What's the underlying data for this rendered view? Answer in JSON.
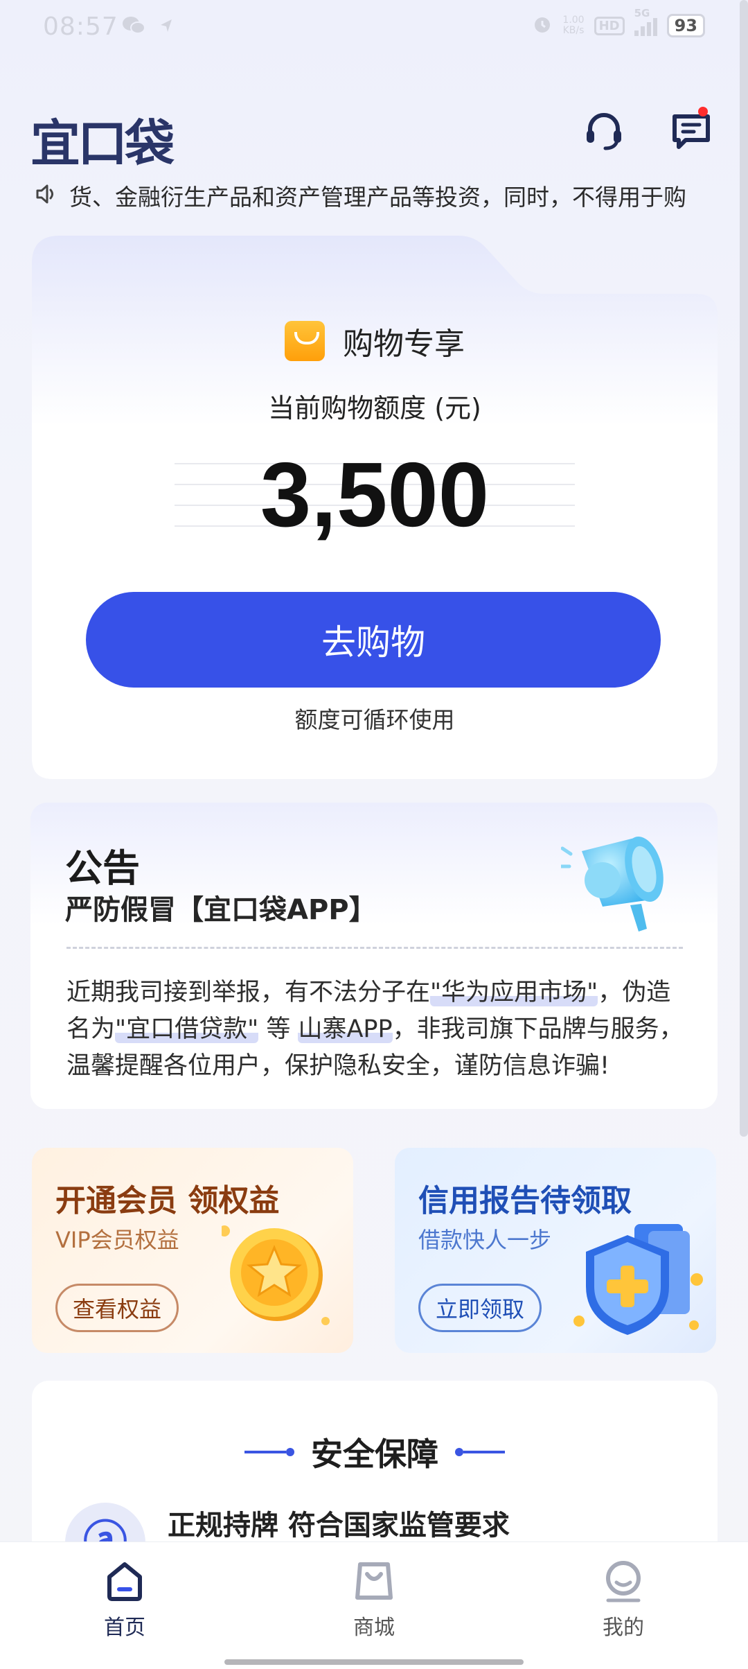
{
  "status_bar": {
    "time": "08:57",
    "net_speed_value": "1.00",
    "net_speed_unit": "KB/s",
    "hd": "HD",
    "network": "5G",
    "battery": "93"
  },
  "header": {
    "logo": "宜口袋"
  },
  "notice_ticker": {
    "text": "货、金融衍生产品和资产管理产品等投资，同时，不得用于购"
  },
  "credit": {
    "tag": "购物专享",
    "caption": "当前购物额度 (元)",
    "amount": "3,500",
    "button": "去购物",
    "note": "额度可循环使用"
  },
  "announcement": {
    "title": "公告",
    "subtitle": "严防假冒【宜口袋APP】",
    "body_1": "近期我司接到举报，有不法分子在",
    "highlight_1": "\"华为应用市场\"",
    "body_2": "，伪造名为",
    "highlight_2": "\"宜口借贷款\"",
    "body_3": " 等 ",
    "highlight_3": "山寨APP",
    "body_4": "，非我司旗下品牌与服务，温馨提醒各位用户，保护隐私安全，谨防信息诈骗!"
  },
  "promos": {
    "vip": {
      "title": "开通会员 领权益",
      "subtitle": "VIP会员权益",
      "button": "查看权益"
    },
    "report": {
      "title": "信用报告待领取",
      "subtitle": "借款快人一步",
      "button": "立即领取"
    }
  },
  "security": {
    "title": "安全保障",
    "item_icon_char": "ⓐ",
    "item_text": "正规持牌 符合国家监管要求"
  },
  "nav": {
    "home": "首页",
    "mall": "商城",
    "mine": "我的"
  },
  "colors": {
    "accent": "#3751e8",
    "logo": "#2a3568"
  }
}
